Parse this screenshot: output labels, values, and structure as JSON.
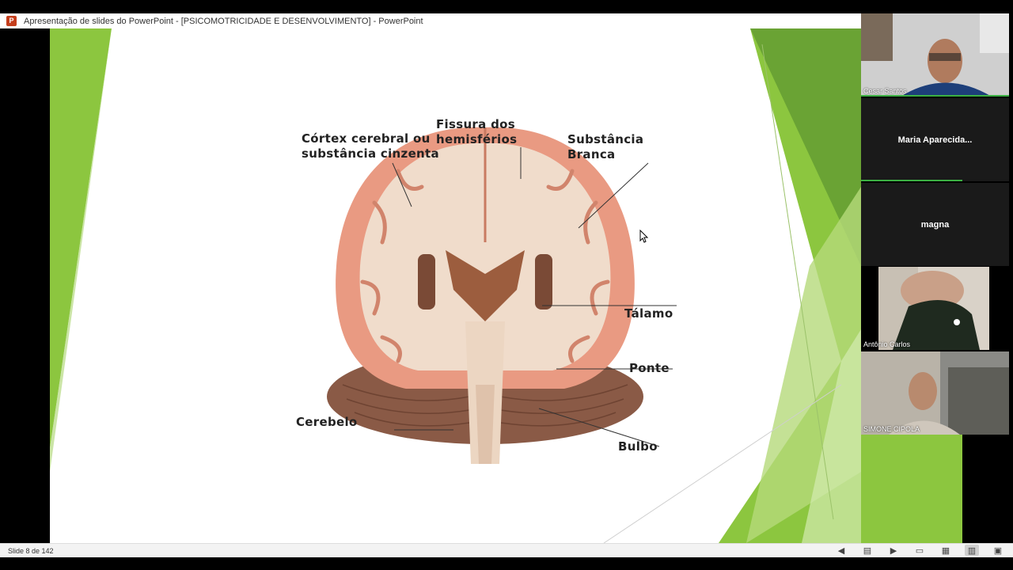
{
  "window": {
    "title": "Apresentação de slides do PowerPoint - [PSICOMOTRICIDADE E DESENVOLVIMENTO] - PowerPoint",
    "app_icon": "powerpoint-icon",
    "app_icon_letter": "P"
  },
  "slide": {
    "labels": {
      "cortex": "Córtex cerebral ou\nsubstância cinzenta",
      "fissura": "Fissura dos\nhemisférios",
      "substancia": "Substância\nBranca",
      "talamo": "Tálamo",
      "ponte": "Ponte",
      "cerebelo": "Cerebelo",
      "bulbo": "Bulbo"
    },
    "accent_color": "#8cc63f"
  },
  "participants": [
    {
      "name": "Cesar Santos",
      "video": true,
      "active_speaker": true
    },
    {
      "name": "Maria  Aparecida...",
      "video": false
    },
    {
      "name": "magna",
      "video": false
    },
    {
      "name": "Antônio Carlos",
      "video": true
    },
    {
      "name": "SIMONE CIPOLA",
      "video": true
    }
  ],
  "statusbar": {
    "slide_count": "Slide 8 de 142",
    "icons": [
      "previous-icon",
      "menu-icon",
      "next-icon",
      "normal-view-icon",
      "slide-sorter-icon",
      "reading-view-icon",
      "slideshow-icon"
    ]
  }
}
